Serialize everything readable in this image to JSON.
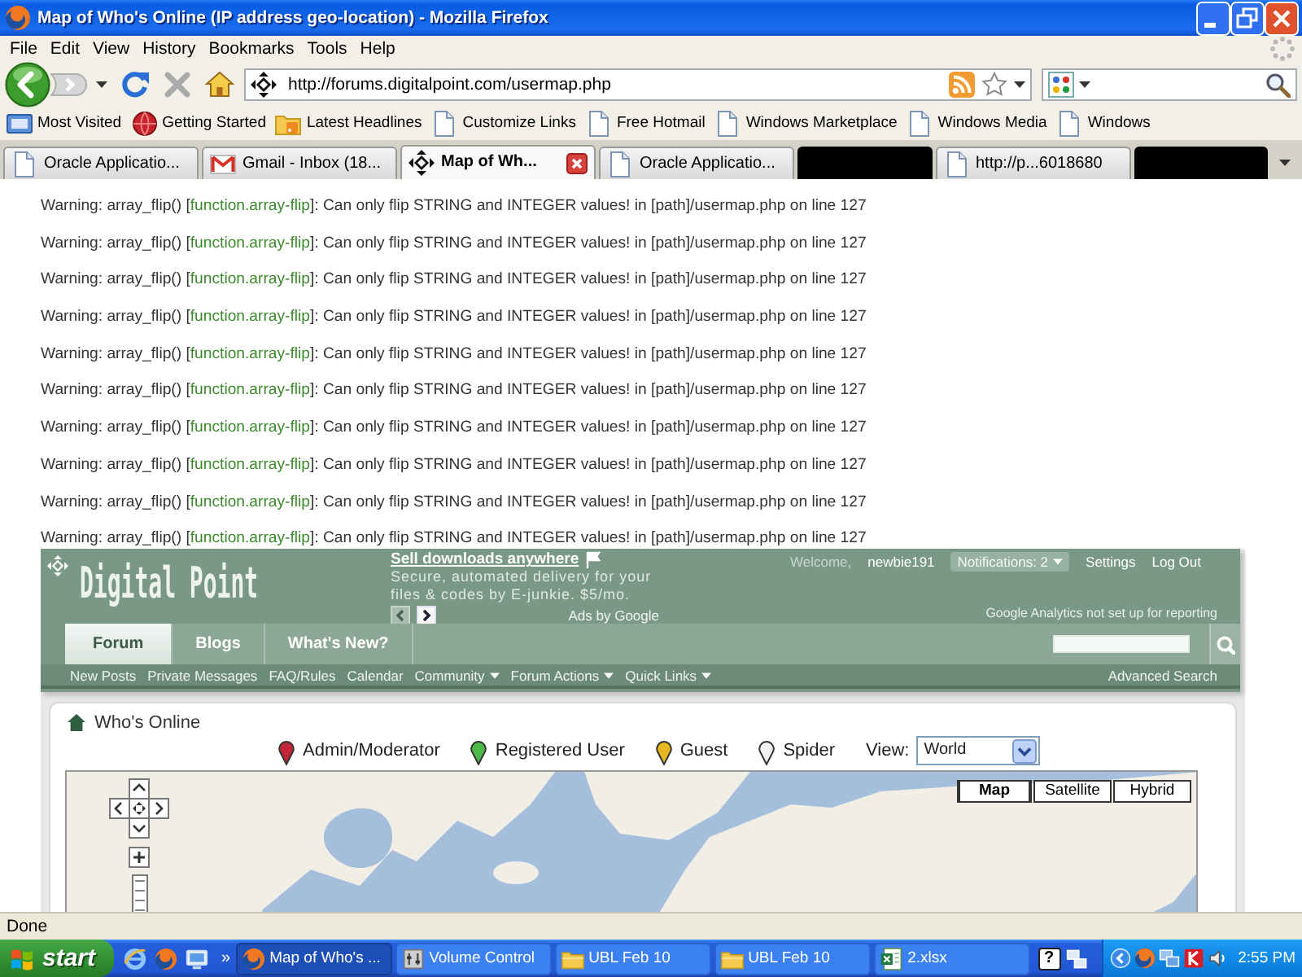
{
  "window": {
    "title": "Map of Who's Online (IP address geo-location) - Mozilla Firefox"
  },
  "menu": [
    "File",
    "Edit",
    "View",
    "History",
    "Bookmarks",
    "Tools",
    "Help"
  ],
  "address_bar": {
    "url": "http://forums.digitalpoint.com/usermap.php"
  },
  "bookmarks": [
    {
      "label": "Most Visited",
      "kind": "smart"
    },
    {
      "label": "Getting Started",
      "kind": "globe"
    },
    {
      "label": "Latest Headlines",
      "kind": "feed"
    },
    {
      "label": "Customize Links",
      "kind": "page"
    },
    {
      "label": "Free Hotmail",
      "kind": "page"
    },
    {
      "label": "Windows Marketplace",
      "kind": "page"
    },
    {
      "label": "Windows Media",
      "kind": "page"
    },
    {
      "label": "Windows",
      "kind": "page"
    }
  ],
  "tabs": [
    {
      "label": "Oracle Applicatio...",
      "kind": "page",
      "selected": false
    },
    {
      "label": "Gmail - Inbox (18...",
      "kind": "mail",
      "selected": false
    },
    {
      "label": "Map of Wh...",
      "kind": "site",
      "selected": true
    },
    {
      "label": "Oracle Applicatio...",
      "kind": "page",
      "selected": false
    },
    {
      "kind": "redacted",
      "selected": false
    },
    {
      "label": "http://p...6018680",
      "kind": "page",
      "selected": false
    },
    {
      "kind": "redacted",
      "selected": false
    }
  ],
  "warnings": [
    {
      "before": "Warning: array_flip() [",
      "link": "function.array-flip",
      "after": "]: Can only flip STRING and INTEGER values! in [path]/usermap.php on line 127"
    },
    {
      "before": "Warning: array_flip() [",
      "link": "function.array-flip",
      "after": "]: Can only flip STRING and INTEGER values! in [path]/usermap.php on line 127"
    },
    {
      "before": "Warning: array_flip() [",
      "link": "function.array-flip",
      "after": "]: Can only flip STRING and INTEGER values! in [path]/usermap.php on line 127"
    },
    {
      "before": "Warning: array_flip() [",
      "link": "function.array-flip",
      "after": "]: Can only flip STRING and INTEGER values! in [path]/usermap.php on line 127"
    },
    {
      "before": "Warning: array_flip() [",
      "link": "function.array-flip",
      "after": "]: Can only flip STRING and INTEGER values! in [path]/usermap.php on line 127"
    },
    {
      "before": "Warning: array_flip() [",
      "link": "function.array-flip",
      "after": "]: Can only flip STRING and INTEGER values! in [path]/usermap.php on line 127"
    },
    {
      "before": "Warning: array_flip() [",
      "link": "function.array-flip",
      "after": "]: Can only flip STRING and INTEGER values! in [path]/usermap.php on line 127"
    },
    {
      "before": "Warning: array_flip() [",
      "link": "function.array-flip",
      "after": "]: Can only flip STRING and INTEGER values! in [path]/usermap.php on line 127"
    },
    {
      "before": "Warning: array_flip() [",
      "link": "function.array-flip",
      "after": "]: Can only flip STRING and INTEGER values! in [path]/usermap.php on line 127"
    },
    {
      "before": "Warning: array_flip() [",
      "link": "function.array-flip",
      "after": "]: Can only flip STRING and INTEGER values! in [path]/usermap.php on line 127"
    }
  ],
  "site_header": {
    "logo": "Digital Point",
    "ad": {
      "title": "Sell downloads anywhere",
      "text": "Secure, automated delivery for your files & codes by E-junkie. $5/mo.",
      "attribution": "Ads by Google"
    },
    "welcome": "Welcome,",
    "username": "newbie191",
    "notifications": "Notifications: 2",
    "links": [
      "Settings",
      "Log Out"
    ],
    "analytics_note": "Google Analytics not set up for reporting",
    "tabs": [
      {
        "label": "Forum",
        "selected": true
      },
      {
        "label": "Blogs",
        "selected": false
      },
      {
        "label": "What's New?",
        "selected": false
      }
    ],
    "subnav": [
      {
        "label": "New Posts",
        "dropdown": false
      },
      {
        "label": "Private Messages",
        "dropdown": false
      },
      {
        "label": "FAQ/Rules",
        "dropdown": false
      },
      {
        "label": "Calendar",
        "dropdown": false
      },
      {
        "label": "Community",
        "dropdown": true
      },
      {
        "label": "Forum Actions",
        "dropdown": true
      },
      {
        "label": "Quick Links",
        "dropdown": true
      }
    ],
    "advanced_search": "Advanced Search"
  },
  "whos_online": {
    "breadcrumb": "Who's Online",
    "legend": [
      {
        "label": "Admin/Moderator",
        "color": "#c0283a"
      },
      {
        "label": "Registered User",
        "color": "#4cb848"
      },
      {
        "label": "Guest",
        "color": "#e8b820"
      },
      {
        "label": "Spider",
        "color": "#f2f2f2"
      }
    ],
    "view": {
      "label": "View:",
      "value": "World"
    },
    "map_types": [
      {
        "label": "Map",
        "selected": true
      },
      {
        "label": "Satellite",
        "selected": false
      },
      {
        "label": "Hybrid",
        "selected": false
      }
    ]
  },
  "status_bar": {
    "text": "Done"
  },
  "taskbar": {
    "start": "start",
    "more": "»",
    "tasks": [
      {
        "label": "Map of Who's ...",
        "kind": "firefox",
        "selected": true
      },
      {
        "label": "Volume Control",
        "kind": "mixer",
        "selected": false
      },
      {
        "label": "UBL Feb 10",
        "kind": "folder",
        "selected": false
      },
      {
        "label": "UBL Feb 10",
        "kind": "folder",
        "selected": false
      },
      {
        "label": "2.xlsx",
        "kind": "sheet",
        "selected": false
      }
    ],
    "help": "?",
    "clock": "2:55 PM"
  }
}
